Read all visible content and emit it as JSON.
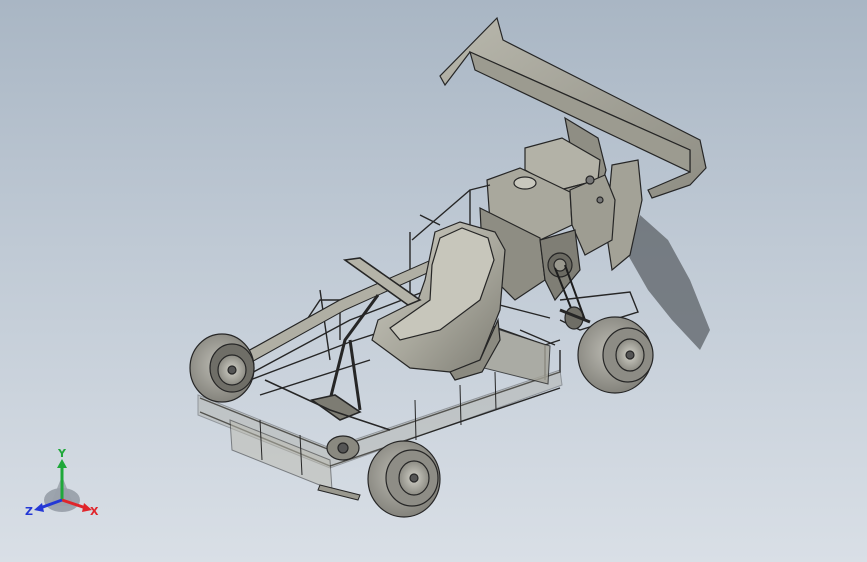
{
  "viewport": {
    "background_top": "#a9b6c4",
    "background_bottom": "#d9dfe6"
  },
  "model": {
    "body_color": "#a9a89b",
    "edge_color": "#2b2b2b",
    "tire_color": "#9f9f97",
    "shadow_color": "#5e646b"
  },
  "triad": {
    "x_label": "X",
    "y_label": "Y",
    "z_label": "Z",
    "x_color": "#e0252b",
    "y_color": "#1fa83a",
    "z_color": "#2438d6"
  }
}
